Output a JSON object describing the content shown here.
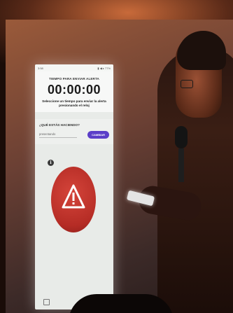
{
  "phone_app": {
    "status_bar": {
      "left": "3:58",
      "right": "▮ ◀ ▸ 77%"
    },
    "timer": {
      "title": "TIEMPO PARA ENVIAR ALERTA",
      "value": "00:00:00",
      "help": "Seleccione un tiempo para enviar la alerta presionando el reloj"
    },
    "activity": {
      "label": "¿QUÉ ESTÁS HACIENDO?",
      "value": "presentando",
      "button_label": "CAMBIAR"
    },
    "info_icon": {
      "icon": "info-icon",
      "glyph": "i"
    },
    "alert_button": {
      "icon": "warning-triangle-icon",
      "color": "#b52c25"
    }
  },
  "colors": {
    "accent_button": "#5b3fc8",
    "alert_red": "#b52c25",
    "stage_light": "#c86a3a"
  }
}
